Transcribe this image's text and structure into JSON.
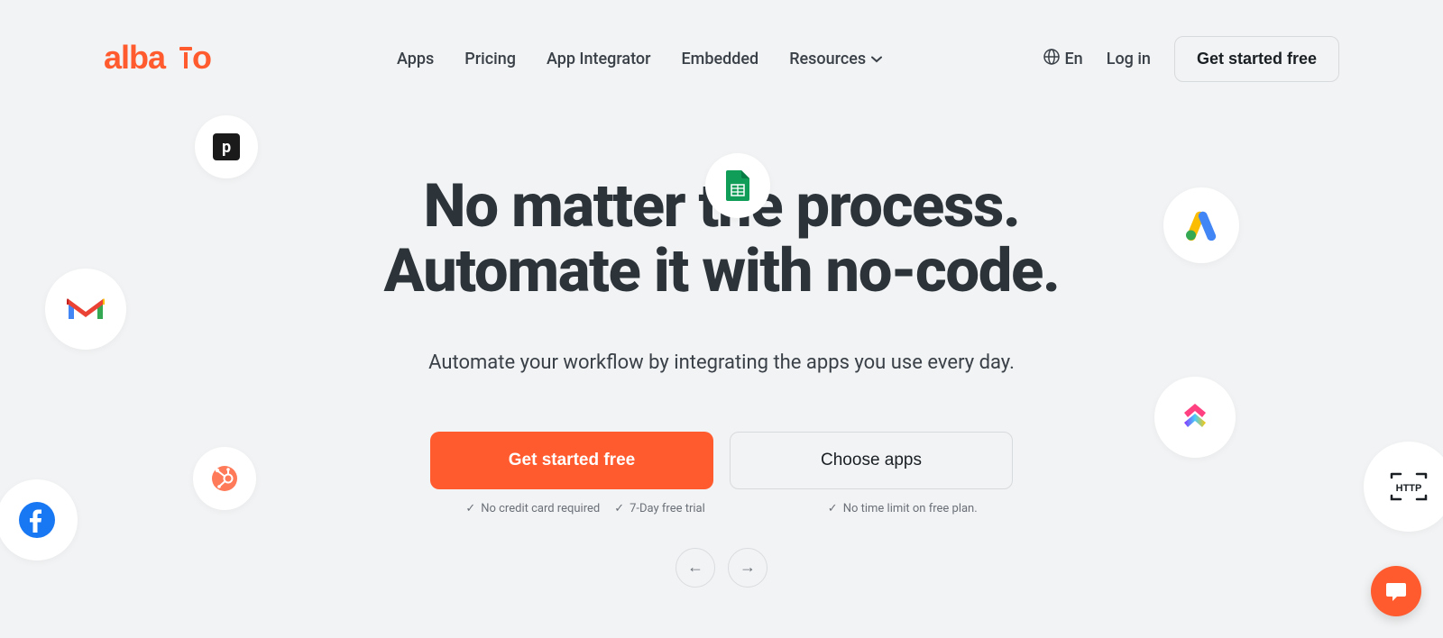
{
  "brand": "albato",
  "nav": {
    "apps": "Apps",
    "pricing": "Pricing",
    "integrator": "App Integrator",
    "embedded": "Embedded",
    "resources": "Resources"
  },
  "header": {
    "lang": "En",
    "login": "Log in",
    "cta": "Get started free"
  },
  "hero": {
    "title_line1": "No matter the process.",
    "title_line2": "Automate it with no-code.",
    "subtitle": "Automate your workflow by integrating the apps you use every day.",
    "cta_primary": "Get started free",
    "cta_secondary": "Choose apps",
    "note1": "No credit card required",
    "note2": "7-Day free trial",
    "note3": "No time limit on free plan."
  },
  "icons": {
    "pipedrive": "p",
    "http": "HTTP"
  }
}
